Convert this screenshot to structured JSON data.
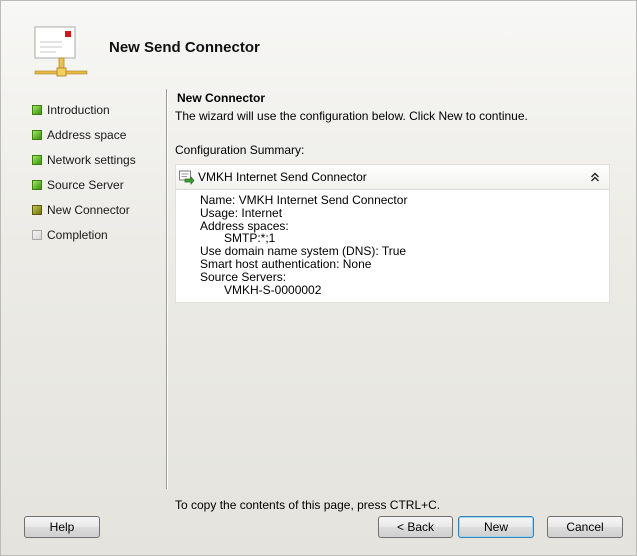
{
  "header": {
    "title": "New Send Connector"
  },
  "steps": [
    {
      "label": "Introduction",
      "state": "completed"
    },
    {
      "label": "Address space",
      "state": "completed"
    },
    {
      "label": "Network settings",
      "state": "completed"
    },
    {
      "label": "Source Server",
      "state": "completed"
    },
    {
      "label": "New Connector",
      "state": "current"
    },
    {
      "label": "Completion",
      "state": "pending"
    }
  ],
  "content": {
    "section_title": "New Connector",
    "intro": "The wizard will use the configuration below.  Click New to continue.",
    "summary_label": "Configuration Summary:",
    "panel_title": "VMKH Internet Send Connector",
    "lines": {
      "name": "Name: VMKH Internet Send Connector",
      "usage": "Usage: Internet",
      "address_spaces_label": "Address spaces:",
      "address_space_value": "SMTP:*;1",
      "dns": "Use domain name system (DNS): True",
      "smart_host_auth": "Smart host authentication: None",
      "source_servers_label": "Source Servers:",
      "source_server_value": "VMKH-S-0000002"
    }
  },
  "footer": {
    "note": "To copy the contents of this page, press CTRL+C."
  },
  "buttons": {
    "help": "Help",
    "back": "< Back",
    "new": "New",
    "cancel": "Cancel"
  },
  "colors": {
    "completed_step": "#5fb52c",
    "current_step": "#8f9320",
    "pending_step": "#d7d7d7",
    "primary_button_border": "#3c7fb1"
  },
  "icons": {
    "wizard": "send-connector-wizard-icon",
    "panel": "send-connector-icon",
    "collapse": "double-chevron-up-icon"
  }
}
